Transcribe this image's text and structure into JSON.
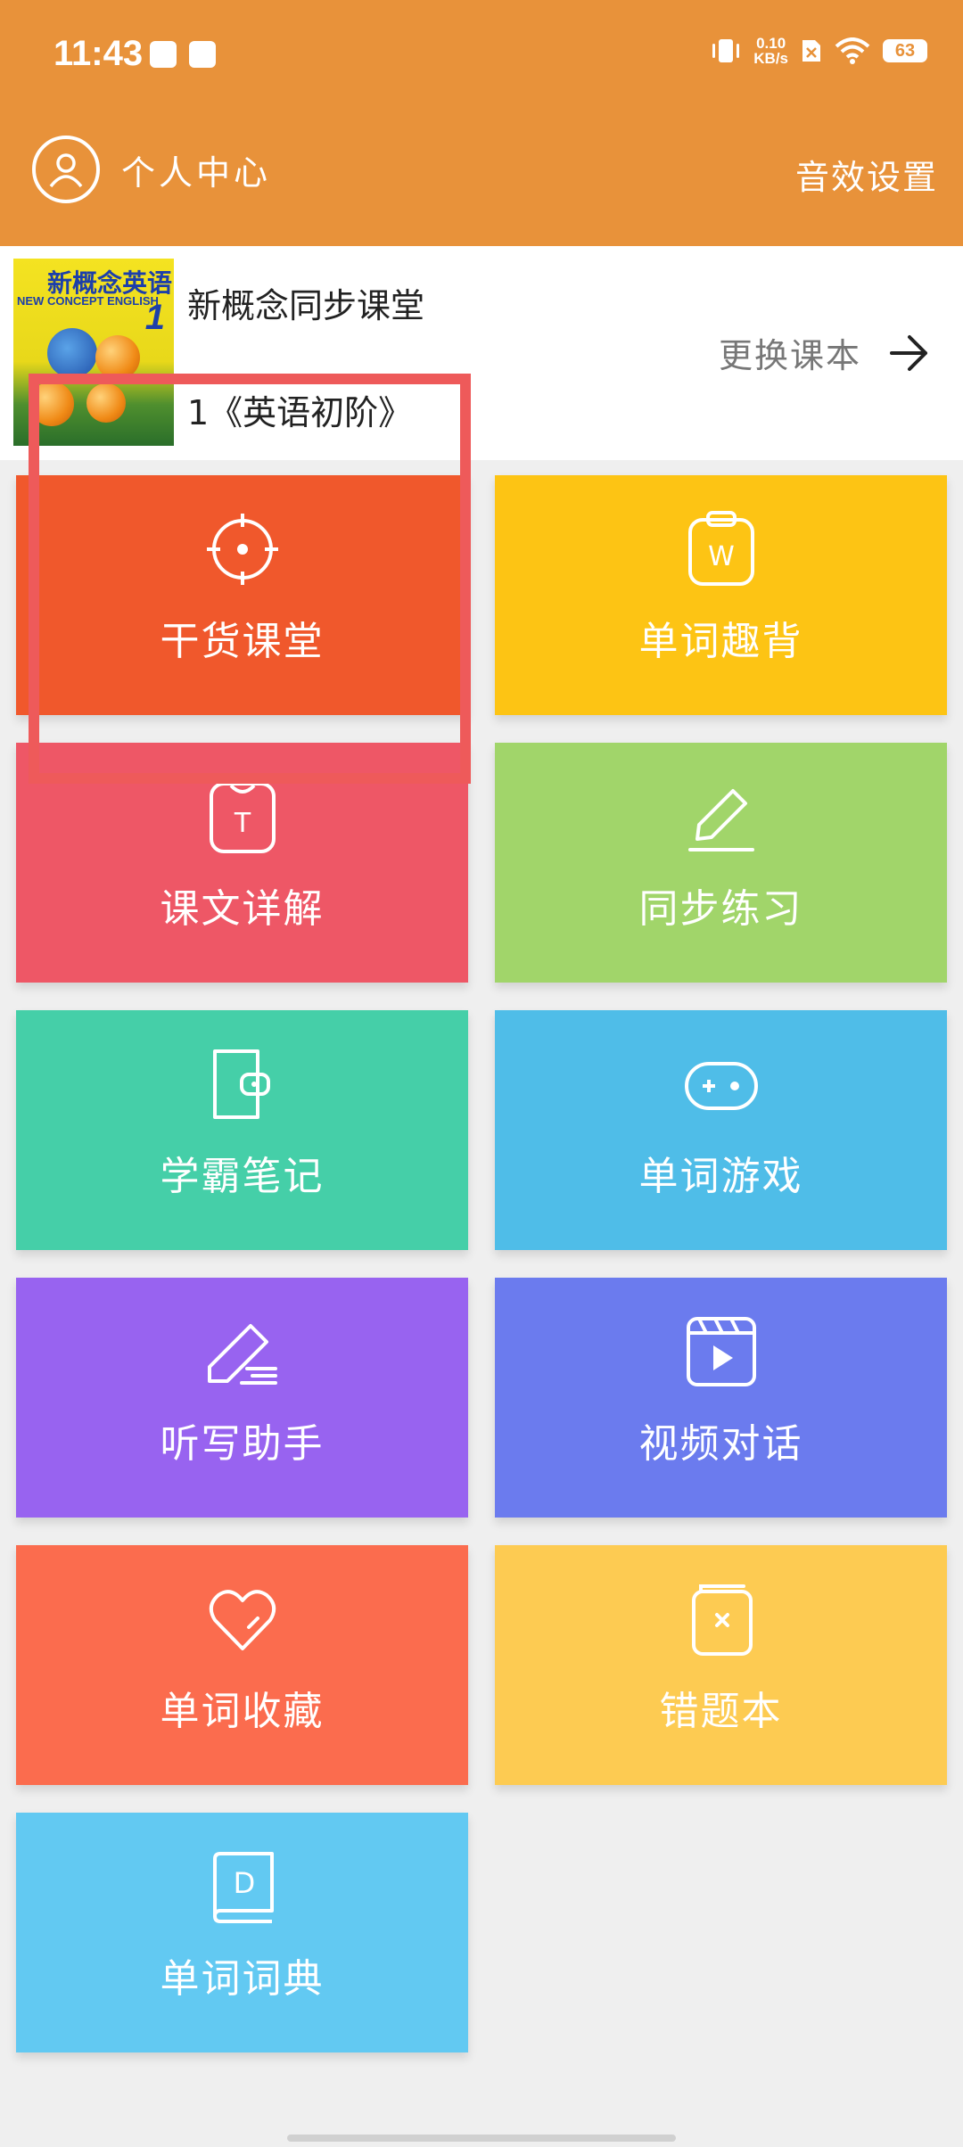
{
  "status_bar": {
    "time": "11:43",
    "net_speed_value": "0.10",
    "net_speed_unit": "KB/s",
    "battery": "63"
  },
  "header": {
    "profile_label": "个人中心",
    "sound_settings_label": "音效设置",
    "background_color": "#e8923a"
  },
  "book": {
    "title": "新概念同步课堂",
    "level": "1《英语初阶》",
    "change_label": "更换课本",
    "cover_title": "新概念英语",
    "cover_subtitle": "NEW CONCEPT ENGLISH",
    "cover_number": "1"
  },
  "menu": [
    {
      "label": "干货课堂",
      "icon": "target-icon",
      "color": "#f0582c"
    },
    {
      "label": "单词趣背",
      "icon": "word-card-icon",
      "color": "#fdc414"
    },
    {
      "label": "课文详解",
      "icon": "text-card-icon",
      "color": "#ee5766"
    },
    {
      "label": "同步练习",
      "icon": "pencil-icon",
      "color": "#a1d56a"
    },
    {
      "label": "学霸笔记",
      "icon": "wallet-note-icon",
      "color": "#45cfa8"
    },
    {
      "label": "单词游戏",
      "icon": "gamepad-icon",
      "color": "#4fbde8"
    },
    {
      "label": "听写助手",
      "icon": "eraser-icon",
      "color": "#9863f0"
    },
    {
      "label": "视频对话",
      "icon": "video-icon",
      "color": "#6b7bee"
    },
    {
      "label": "单词收藏",
      "icon": "heart-icon",
      "color": "#fb6c4e"
    },
    {
      "label": "错题本",
      "icon": "error-book-icon",
      "color": "#fdcb52"
    },
    {
      "label": "单词词典",
      "icon": "dictionary-icon",
      "color": "#62c9f2"
    }
  ],
  "highlight_color": "#ee5a5a"
}
